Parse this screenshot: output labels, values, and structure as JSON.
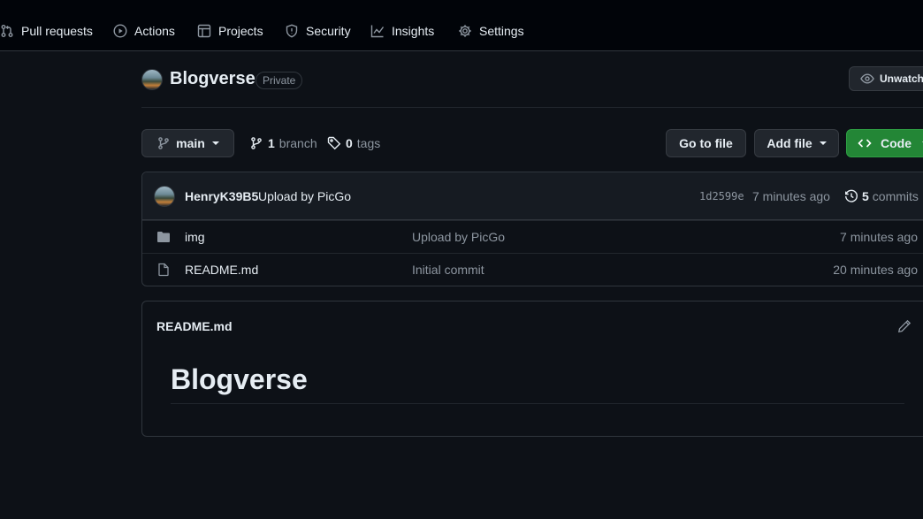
{
  "nav": {
    "items": [
      {
        "label": "Pull requests",
        "icon": "pull-request-icon"
      },
      {
        "label": "Actions",
        "icon": "play-icon"
      },
      {
        "label": "Projects",
        "icon": "table-icon"
      },
      {
        "label": "Security",
        "icon": "shield-icon"
      },
      {
        "label": "Insights",
        "icon": "graph-icon"
      },
      {
        "label": "Settings",
        "icon": "gear-icon"
      }
    ]
  },
  "repo": {
    "name": "Blogverse",
    "visibility": "Private",
    "unwatch_label": "Unwatch"
  },
  "branch_bar": {
    "current_branch": "main",
    "branch_count": "1",
    "branch_label": "branch",
    "tag_count": "0",
    "tag_label": "tags",
    "go_to_file": "Go to file",
    "add_file": "Add file",
    "code": "Code"
  },
  "latest_commit": {
    "author": "HenryK39B5",
    "message": "Upload by PicGo",
    "sha": "1d2599e",
    "time": "7 minutes ago",
    "commit_count": "5",
    "commits_label": "commits"
  },
  "files": [
    {
      "type": "folder",
      "name": "img",
      "message": "Upload by PicGo",
      "time": "7 minutes ago"
    },
    {
      "type": "file",
      "name": "README.md",
      "message": "Initial commit",
      "time": "20 minutes ago"
    }
  ],
  "readme": {
    "filename": "README.md",
    "heading": "Blogverse"
  },
  "colors": {
    "background": "#0d1117",
    "nav_background": "#010409",
    "border": "#30363d",
    "accent_green": "#238636",
    "text": "#e6edf3",
    "muted": "#8d96a0"
  }
}
